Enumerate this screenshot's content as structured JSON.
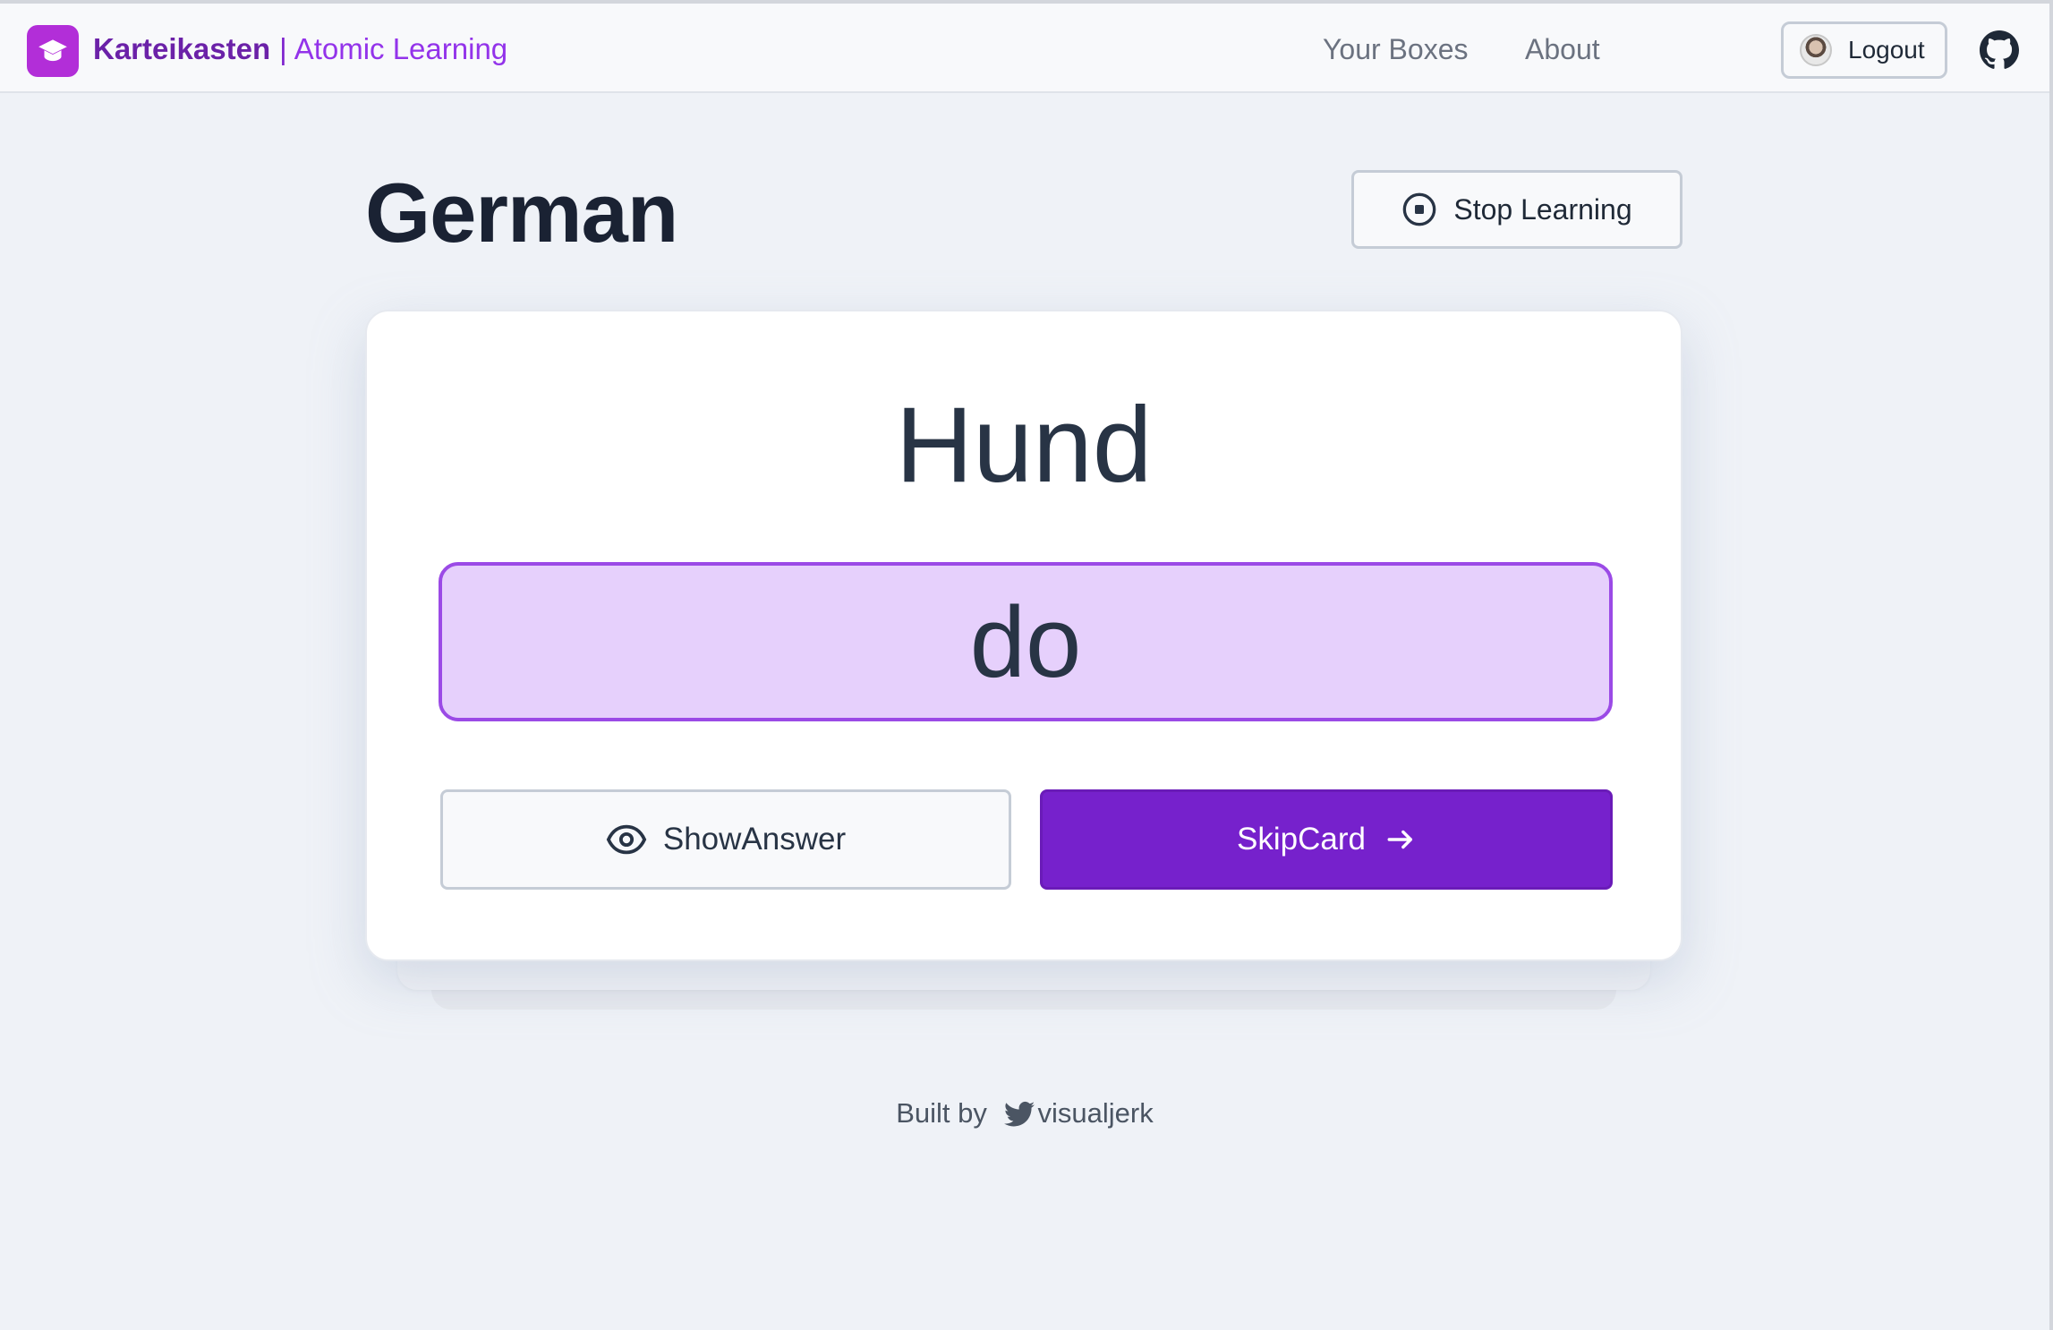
{
  "header": {
    "brand_name": "Karteikasten",
    "brand_separator": "|",
    "brand_subtitle": "Atomic Learning",
    "nav": [
      {
        "label": "Your Boxes"
      },
      {
        "label": "About"
      }
    ],
    "logout_label": "Logout"
  },
  "main": {
    "title": "German",
    "stop_button_label": "Stop Learning"
  },
  "card": {
    "word": "Hund",
    "answer_value": "do",
    "show_answer_label": "ShowAnswer",
    "skip_card_label": "SkipCard"
  },
  "footer": {
    "built_by": "Built by",
    "author": "visualjerk"
  },
  "colors": {
    "accent": "#7621cc",
    "brand": "#6b21a8",
    "input_bg": "#e6d0fc",
    "input_border": "#9b4ae6"
  },
  "icons": [
    "graduation-cap-icon",
    "github-icon",
    "stop-circle-icon",
    "eye-icon",
    "arrow-right-icon",
    "twitter-icon"
  ]
}
